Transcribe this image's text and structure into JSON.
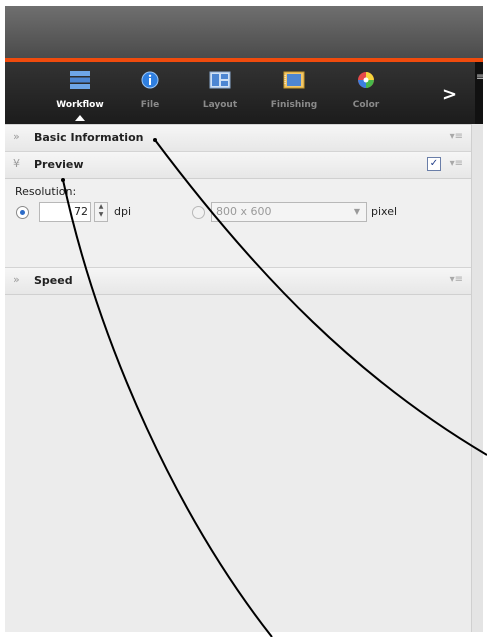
{
  "toolbar": {
    "tabs": [
      {
        "label": "Workflow",
        "icon": "workflow-icon",
        "active": true
      },
      {
        "label": "File",
        "icon": "info-icon",
        "active": false
      },
      {
        "label": "Layout",
        "icon": "layout-icon",
        "active": false
      },
      {
        "label": "Finishing",
        "icon": "finishing-icon",
        "active": false
      },
      {
        "label": "Color",
        "icon": "color-wheel-icon",
        "active": false
      }
    ],
    "more_glyph": ">"
  },
  "sections": {
    "basic_information": {
      "title": "Basic Information",
      "expand_glyph": "»",
      "menu_glyph": "▾≡"
    },
    "preview": {
      "title": "Preview",
      "expand_glyph": "¥",
      "menu_glyph": "▾≡",
      "enabled_check": "✓"
    },
    "speed": {
      "title": "Speed",
      "expand_glyph": "»",
      "menu_glyph": "▾≡"
    }
  },
  "preview": {
    "resolution_label": "Resolution:",
    "dpi_value": "72",
    "dpi_unit": "dpi",
    "pixel_size_value": "800 x 600",
    "pixel_unit": "pixel",
    "mode_selected": "dpi"
  },
  "colors": {
    "accent_orange": "#f04b0d",
    "toolbar_bg": "#1c1c1c"
  }
}
